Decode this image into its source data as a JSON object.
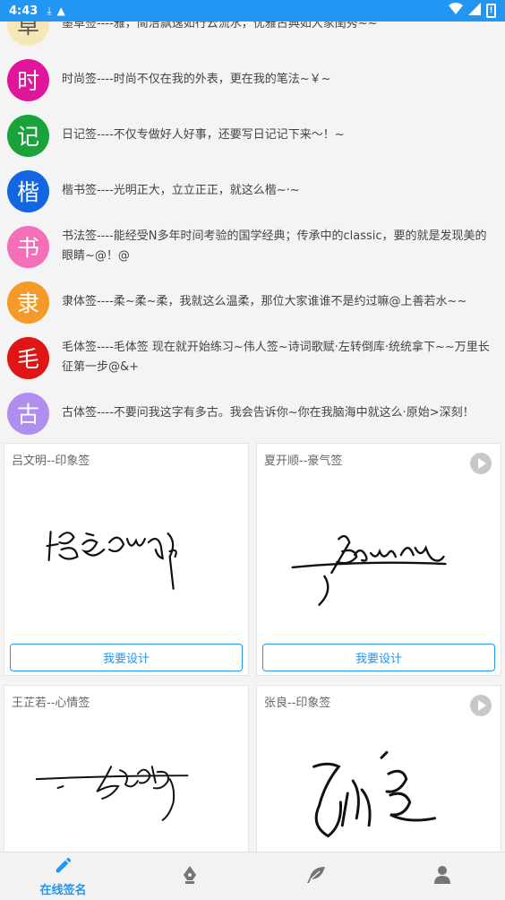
{
  "status_bar": {
    "time": "4:43"
  },
  "categories": [
    {
      "icon_char": "草",
      "color": "#f5e7b8",
      "text_color": "#555555",
      "text": "墨草签----雅，简洁飘逸如行云流水，优雅古典如大家闺秀~~"
    },
    {
      "icon_char": "时",
      "color": "#e0169a",
      "text_color": "#ffffff",
      "text": "时尚签----时尚不仅在我的外表，更在我的笔法~￥~"
    },
    {
      "icon_char": "记",
      "color": "#1aa33a",
      "text_color": "#ffffff",
      "text": "日记签----不仅专做好人好事，还要写日记记下来～！~"
    },
    {
      "icon_char": "楷",
      "color": "#1266e0",
      "text_color": "#ffffff",
      "text": "楷书签----光明正大，立立正正，就这么楷~·~"
    },
    {
      "icon_char": "书",
      "color": "#f56fb8",
      "text_color": "#ffffff",
      "text": "书法签----能经受N多年时间考验的国学经典；传承中的classic，要的就是发现美的眼睛~@！@"
    },
    {
      "icon_char": "隶",
      "color": "#f59a28",
      "text_color": "#ffffff",
      "text": "隶体签----柔~柔~柔，我就这么温柔，那位大家谁谁不是约过嘛@上善若水~~"
    },
    {
      "icon_char": "毛",
      "color": "#e01515",
      "text_color": "#ffffff",
      "text": "毛体签----毛体签  现在就开始练习~伟人签~诗词歌赋·左转倒库·统统拿下~~万里长征第一步@&+"
    },
    {
      "icon_char": "古",
      "color": "#b08ef0",
      "text_color": "#ffffff",
      "text": "古体签----不要问我这字有多古。我会告诉你~你在我脑海中就这么·原始>深刻！"
    }
  ],
  "cards": [
    {
      "title": "吕文明--印象签",
      "has_play": false,
      "button": "我要设计"
    },
    {
      "title": "夏开顺--豪气签",
      "has_play": true,
      "button": "我要设计"
    },
    {
      "title": "王芷若--心情签",
      "has_play": false,
      "button": ""
    },
    {
      "title": "张良--印象签",
      "has_play": true,
      "button": ""
    }
  ],
  "bottom_nav": [
    {
      "label": "在线签名",
      "icon": "pen-icon",
      "active": true
    },
    {
      "label": "",
      "icon": "fountain-pen-icon",
      "active": false
    },
    {
      "label": "",
      "icon": "feather-icon",
      "active": false
    },
    {
      "label": "",
      "icon": "person-icon",
      "active": false
    }
  ],
  "colors": {
    "accent": "#2196f3"
  }
}
